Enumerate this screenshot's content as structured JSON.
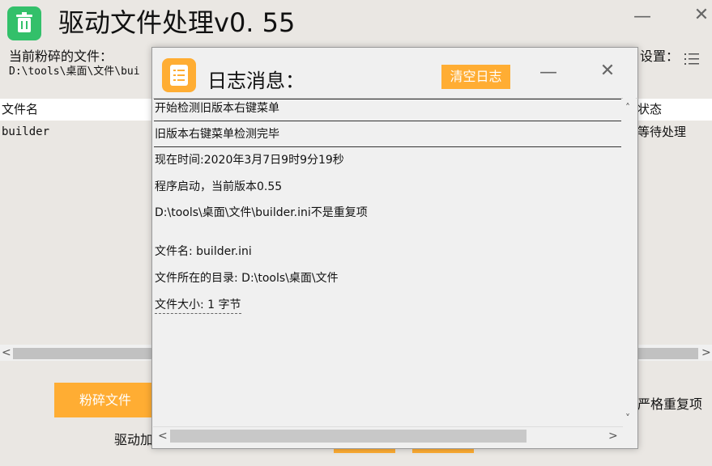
{
  "window": {
    "title": "驱动文件处理v0. 55",
    "minimize_glyph": "—",
    "close_glyph": "✕",
    "icon": "trash-icon"
  },
  "main": {
    "current_file_label": "当前粉碎的文件：",
    "current_file_path": "D:\\tools\\桌面\\文件\\bui",
    "settings_label": "设置：",
    "settings_icon": "list-icon",
    "columns": [
      "文件名",
      "状态"
    ],
    "rows": [
      {
        "name": "builder",
        "status": "等待处理"
      }
    ],
    "shred_button": "粉碎文件",
    "bottom_left_text": "驱动加",
    "bottom_right_text": "严格重复项"
  },
  "dialog": {
    "title": "日志消息：",
    "icon": "log-list-icon",
    "clear_button": "清空日志",
    "minimize_glyph": "—",
    "close_glyph": "✕",
    "log_lines": [
      "开始检测旧版本右键菜单",
      "旧版本右键菜单检测完毕",
      "现在时间:2020年3月7日9时9分19秒",
      "程序启动，当前版本0.55",
      "D:\\tools\\桌面\\文件\\builder.ini不是重复项",
      "文件名: builder.ini",
      "文件所在的目录: D:\\tools\\桌面\\文件",
      "文件大小: 1 字节"
    ]
  },
  "colors": {
    "accent_orange": "#ffad33",
    "app_icon_green": "#33c06a",
    "background": "#eae7e3"
  }
}
